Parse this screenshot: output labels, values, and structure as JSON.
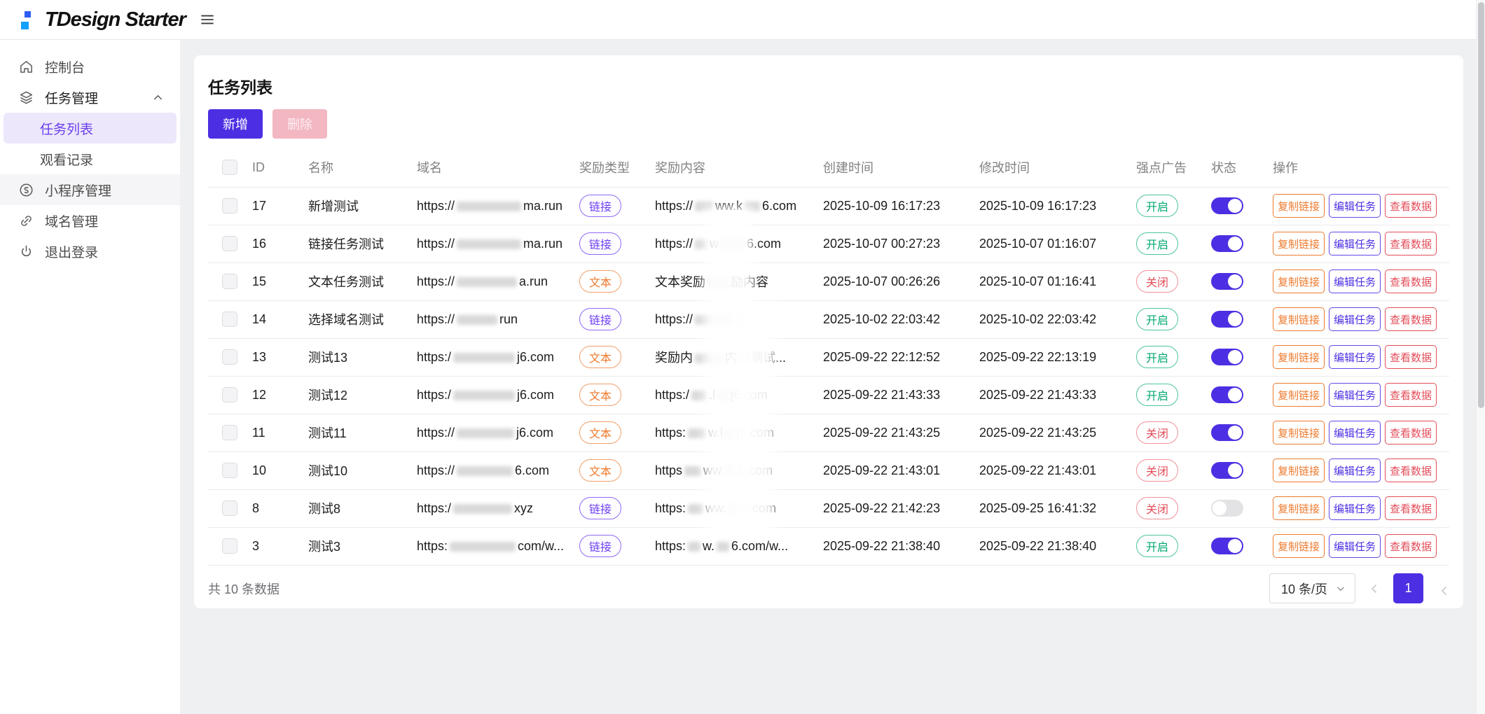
{
  "header": {
    "logo_text": "TDesign Starter"
  },
  "sidebar": {
    "items": [
      {
        "label": "控制台"
      },
      {
        "label": "任务管理"
      },
      {
        "label": "任务列表"
      },
      {
        "label": "观看记录"
      },
      {
        "label": "小程序管理"
      },
      {
        "label": "域名管理"
      },
      {
        "label": "退出登录"
      }
    ]
  },
  "page": {
    "title": "任务列表",
    "toolbar": {
      "add_label": "新增",
      "delete_label": "删除"
    },
    "table": {
      "columns": [
        "",
        "ID",
        "名称",
        "域名",
        "奖励类型",
        "奖励内容",
        "创建时间",
        "修改时间",
        "强点广告",
        "状态",
        "操作"
      ],
      "actions": [
        {
          "label": "复制链接",
          "kind": "copy"
        },
        {
          "label": "编辑任务",
          "kind": "edit"
        },
        {
          "label": "查看数据",
          "kind": "view"
        }
      ],
      "rows": [
        {
          "id": "17",
          "name": "新增测试",
          "domain": [
            "https://",
            {
              "blur": 92
            },
            "ma.run"
          ],
          "reward_type": "链接",
          "reward_kind": "link",
          "reward_content": [
            "https://",
            {
              "blur": 26
            },
            "ww.k",
            {
              "blur": 22
            },
            "6.com"
          ],
          "created": "2025-10-09 16:17:23",
          "modified": "2025-10-09 16:17:23",
          "ad": "开启",
          "ad_state": "on",
          "status_on": true
        },
        {
          "id": "16",
          "name": "链接任务测试",
          "domain": [
            "https://",
            {
              "blur": 92
            },
            "ma.run"
          ],
          "reward_type": "链接",
          "reward_kind": "link",
          "reward_content": [
            "https://",
            {
              "blur": 18
            },
            "w",
            {
              "blur": 34
            },
            "6.com"
          ],
          "created": "2025-10-07 00:27:23",
          "modified": "2025-10-07 01:16:07",
          "ad": "开启",
          "ad_state": "on",
          "status_on": true
        },
        {
          "id": "15",
          "name": "文本任务测试",
          "domain": [
            "https://",
            {
              "blur": 86
            },
            "a.run"
          ],
          "reward_type": "文本",
          "reward_kind": "text",
          "reward_content": [
            "文本奖励",
            {
              "blur": 30
            },
            "励内容"
          ],
          "created": "2025-10-07 00:26:26",
          "modified": "2025-10-07 01:16:41",
          "ad": "关闭",
          "ad_state": "off",
          "status_on": true
        },
        {
          "id": "14",
          "name": "选择域名测试",
          "domain": [
            "https://",
            {
              "blur": 58
            },
            "run"
          ],
          "reward_type": "链接",
          "reward_kind": "link",
          "reward_content": [
            "https://",
            {
              "blur": 64
            }
          ],
          "created": "2025-10-02 22:03:42",
          "modified": "2025-10-02 22:03:42",
          "ad": "开启",
          "ad_state": "on",
          "status_on": true
        },
        {
          "id": "13",
          "name": "测试13",
          "domain": [
            "https:/",
            {
              "blur": 88
            },
            "j6.com"
          ],
          "reward_type": "文本",
          "reward_kind": "text",
          "reward_content": [
            "奖励内",
            {
              "blur": 40
            },
            "内容测试..."
          ],
          "created": "2025-09-22 22:12:52",
          "modified": "2025-09-22 22:13:19",
          "ad": "开启",
          "ad_state": "on",
          "status_on": true
        },
        {
          "id": "12",
          "name": "测试12",
          "domain": [
            "https:/",
            {
              "blur": 88
            },
            "j6.com"
          ],
          "reward_type": "文本",
          "reward_kind": "text",
          "reward_content": [
            "https:/",
            {
              "blur": 22
            },
            ".l",
            {
              "blur": 16
            },
            "j6.com"
          ],
          "created": "2025-09-22 21:43:33",
          "modified": "2025-09-22 21:43:33",
          "ad": "开启",
          "ad_state": "on",
          "status_on": true
        },
        {
          "id": "11",
          "name": "测试11",
          "domain": [
            "https://",
            {
              "blur": 82
            },
            "j6.com"
          ],
          "reward_type": "文本",
          "reward_kind": "text",
          "reward_content": [
            "https:",
            {
              "blur": 26
            },
            "w.l",
            {
              "blur": 14
            },
            "j6.com"
          ],
          "created": "2025-09-22 21:43:25",
          "modified": "2025-09-22 21:43:25",
          "ad": "关闭",
          "ad_state": "off",
          "status_on": true
        },
        {
          "id": "10",
          "name": "测试10",
          "domain": [
            "https://",
            {
              "blur": 80
            },
            "6.com"
          ],
          "reward_type": "文本",
          "reward_kind": "text",
          "reward_content": [
            "https",
            {
              "blur": 24
            },
            "ww.",
            {
              "blur": 14
            },
            "6.com"
          ],
          "created": "2025-09-22 21:43:01",
          "modified": "2025-09-22 21:43:01",
          "ad": "关闭",
          "ad_state": "off",
          "status_on": true
        },
        {
          "id": "8",
          "name": "测试8",
          "domain": [
            "https:/",
            {
              "blur": 84
            },
            "xyz"
          ],
          "reward_type": "链接",
          "reward_kind": "link",
          "reward_content": [
            "https:",
            {
              "blur": 22
            },
            "ww.",
            {
              "blur": 16
            },
            "6.com"
          ],
          "created": "2025-09-22 21:42:23",
          "modified": "2025-09-25 16:41:32",
          "ad": "关闭",
          "ad_state": "off",
          "status_on": false
        },
        {
          "id": "3",
          "name": "测试3",
          "domain": [
            "https:",
            {
              "blur": 94
            },
            "com/w..."
          ],
          "reward_type": "链接",
          "reward_kind": "link",
          "reward_content": [
            "https:",
            {
              "blur": 18
            },
            "w.",
            {
              "blur": 18
            },
            "6.com/w..."
          ],
          "created": "2025-09-22 21:38:40",
          "modified": "2025-09-22 21:38:40",
          "ad": "开启",
          "ad_state": "on",
          "status_on": true
        }
      ]
    },
    "footer": {
      "total": "共 10 条数据",
      "page_size": "10 条/页",
      "current_page": "1"
    }
  },
  "colors": {
    "accent": "#4D2FE3",
    "accent_light_bg": "#EDE7FC",
    "link_tag": "#6E3FF3",
    "warning": "#ED7B2F",
    "danger": "#E34D59",
    "success": "#00A870",
    "delete_disabled_bg": "#F3B7C2"
  }
}
